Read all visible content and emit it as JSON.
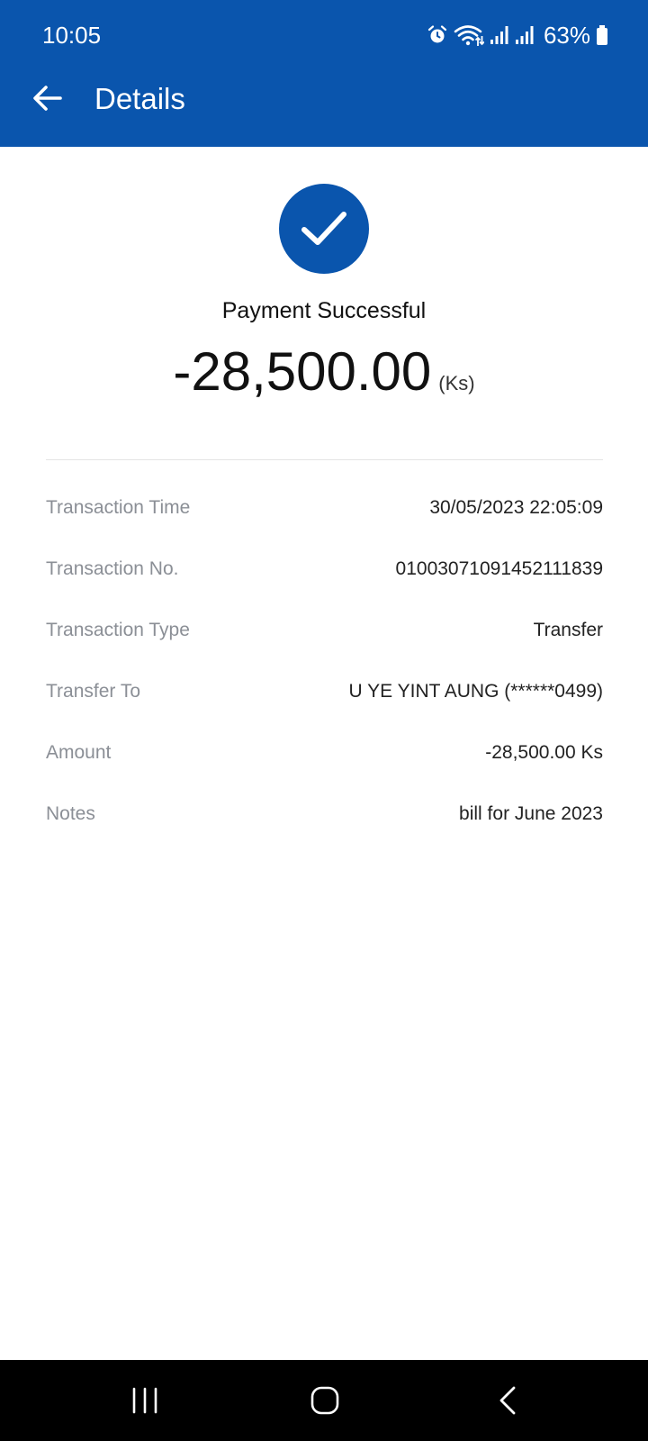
{
  "status_bar": {
    "time": "10:05",
    "battery_percent": "63%",
    "icons": [
      "alarm-icon",
      "wifi-icon",
      "signal-icon",
      "signal-icon",
      "battery-icon"
    ]
  },
  "header": {
    "title": "Details",
    "background_color": "#0a55ad"
  },
  "result": {
    "status": "Payment Successful",
    "amount": "-28,500.00",
    "currency": "(Ks)",
    "icon": "check-icon"
  },
  "details": [
    {
      "label": "Transaction Time",
      "value": "30/05/2023 22:05:09"
    },
    {
      "label": "Transaction No.",
      "value": "01003071091452111839"
    },
    {
      "label": "Transaction Type",
      "value": "Transfer"
    },
    {
      "label": "Transfer To",
      "value": "U YE YINT AUNG (******0499)"
    },
    {
      "label": "Amount",
      "value": "-28,500.00 Ks"
    },
    {
      "label": "Notes",
      "value": "bill for June 2023"
    }
  ],
  "nav_bar": {
    "buttons": [
      "recent-apps-icon",
      "home-icon",
      "back-icon"
    ]
  }
}
